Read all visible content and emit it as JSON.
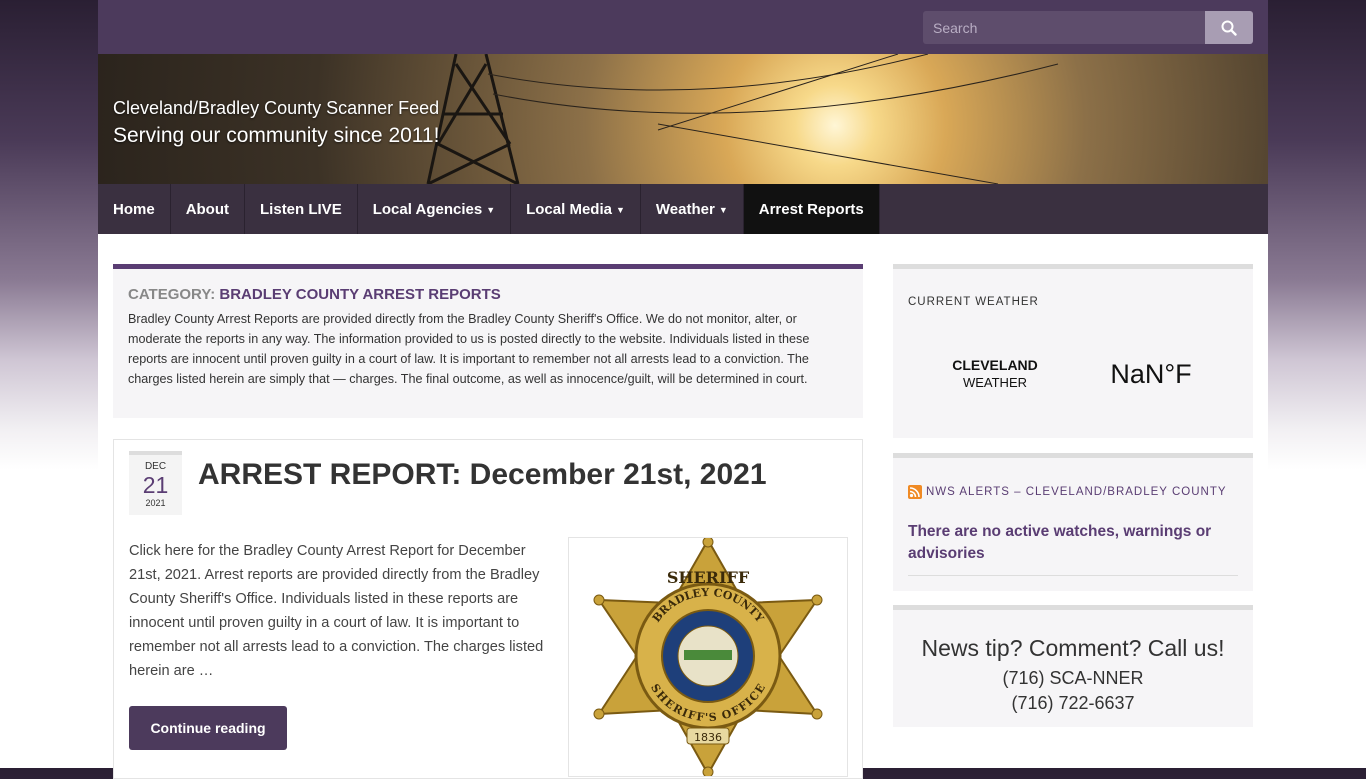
{
  "search": {
    "placeholder": "Search"
  },
  "header": {
    "site_title": "Cleveland/Bradley County Scanner Feed",
    "tagline": "Serving our community since 2011!"
  },
  "nav": {
    "items": [
      {
        "label": "Home",
        "dropdown": false
      },
      {
        "label": "About",
        "dropdown": false
      },
      {
        "label": "Listen LIVE",
        "dropdown": false
      },
      {
        "label": "Local Agencies",
        "dropdown": true
      },
      {
        "label": "Local Media",
        "dropdown": true
      },
      {
        "label": "Weather",
        "dropdown": true
      },
      {
        "label": "Arrest Reports",
        "dropdown": false,
        "active": true
      }
    ]
  },
  "category": {
    "prefix": "Category:",
    "name": "Bradley County Arrest Reports",
    "description": "Bradley County Arrest Reports are provided directly from the Bradley County Sheriff's Office. We do not monitor, alter, or moderate the reports in any way. The information provided to us is posted directly to the website. Individuals listed in these reports are innocent until proven guilty in a court of law. It is important to remember not all arrests lead to a conviction. The charges listed herein are simply that — charges. The final outcome, as well as innocence/guilt, will be determined in court."
  },
  "post": {
    "date": {
      "month": "DEC",
      "day": "21",
      "year": "2021"
    },
    "title": "ARREST REPORT: December 21st, 2021",
    "excerpt": "Click here for the Bradley County Arrest Report for December 21st, 2021. Arrest reports are provided directly from the Bradley County Sheriff's Office. Individuals listed in these reports are innocent until proven guilty in a court of law. It is important to remember not all arrests lead to a conviction. The charges listed herein are …",
    "continue_label": "Continue reading",
    "badge": {
      "top_text": "SHERIFF",
      "ring_top": "BRADLEY COUNTY",
      "ring_bottom": "SHERIFF'S OFFICE",
      "year": "1836"
    }
  },
  "sidebar": {
    "weather": {
      "title": "Current Weather",
      "city": "CLEVELAND",
      "label": "WEATHER",
      "temp": "NaN°F"
    },
    "alerts": {
      "title": "NWS Alerts – Cleveland/Bradley County",
      "text": "There are no active watches, warnings or advisories"
    },
    "tip": {
      "title": "News tip? Comment? Call us!",
      "phone1": "(716) SCA-NNER",
      "phone2": "(716) 722-6637"
    }
  },
  "colors": {
    "brand_purple": "#4c3a5c",
    "accent_purple": "#5a3d73",
    "nav_bg": "#3a3040",
    "rss_orange": "#f08a24"
  }
}
